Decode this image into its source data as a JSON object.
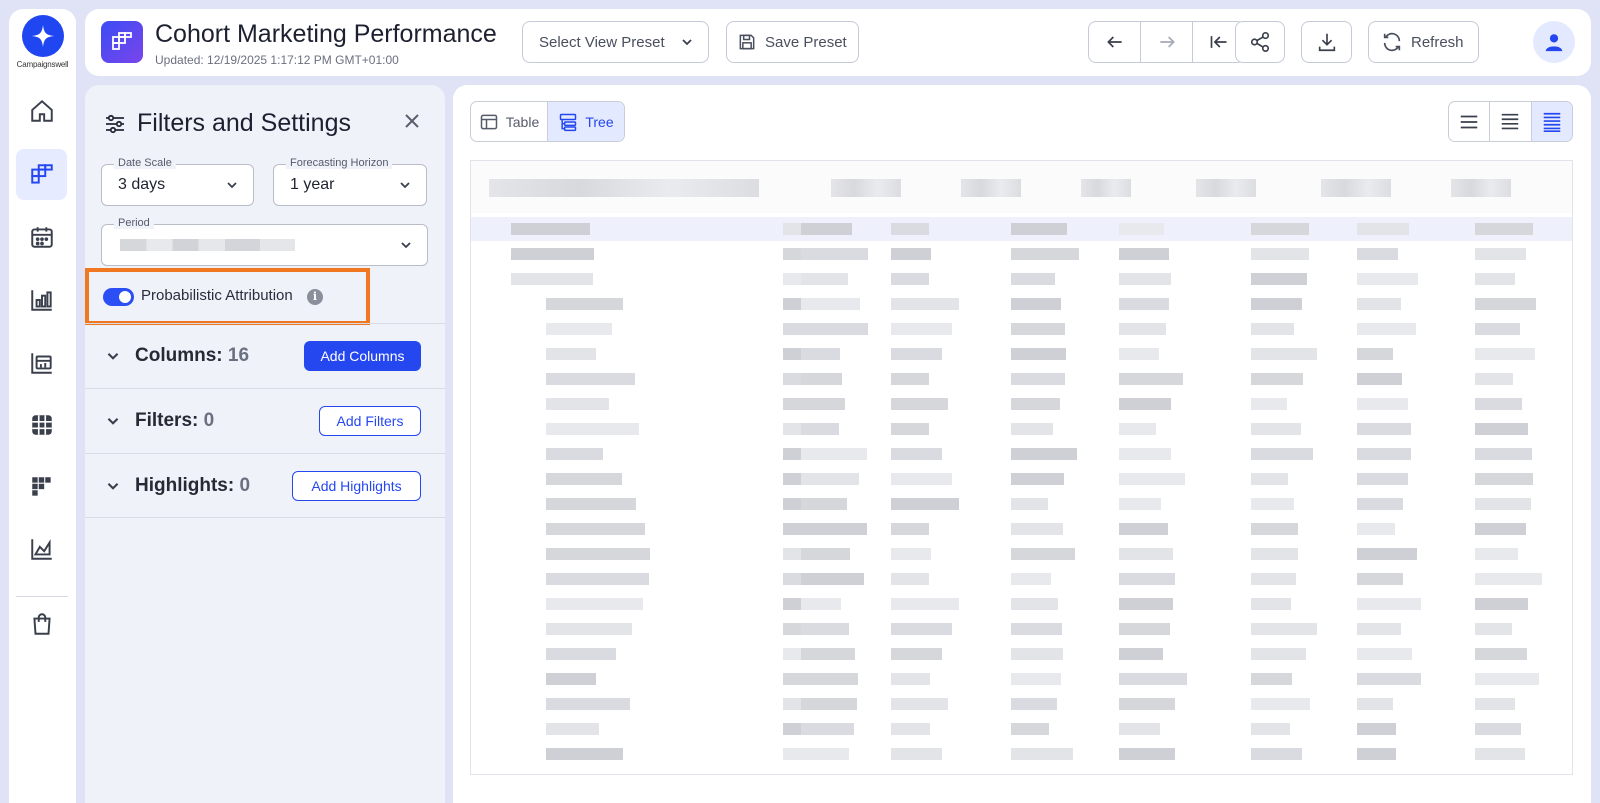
{
  "brand": {
    "name": "Campaignswell",
    "accent": "#2547f0",
    "highlight": "#f07820"
  },
  "header": {
    "title": "Cohort Marketing Performance",
    "updated": "Updated: 12/19/2025 1:17:12 PM GMT+01:00",
    "preset_select": "Select View Preset",
    "save_preset": "Save Preset",
    "refresh": "Refresh"
  },
  "sidebar": {
    "items": [
      {
        "icon": "home-icon",
        "active": false
      },
      {
        "icon": "cohort-icon",
        "active": true
      },
      {
        "icon": "calendar-icon",
        "active": false
      },
      {
        "icon": "bar-chart-icon",
        "active": false
      },
      {
        "icon": "calendar-chart-icon",
        "active": false
      },
      {
        "icon": "grid-icon",
        "active": false
      },
      {
        "icon": "heatmap-icon",
        "active": false
      },
      {
        "icon": "line-chart-icon",
        "active": false
      },
      {
        "icon": "shopping-bag-icon",
        "active": false
      }
    ]
  },
  "filters": {
    "title": "Filters and Settings",
    "date_scale": {
      "label": "Date Scale",
      "value": "3 days"
    },
    "forecasting_horizon": {
      "label": "Forecasting Horizon",
      "value": "1 year"
    },
    "period": {
      "label": "Period",
      "value": ""
    },
    "probabilistic_attribution": {
      "label": "Probabilistic Attribution",
      "enabled": true
    },
    "columns": {
      "label": "Columns:",
      "count": "16",
      "button": "Add Columns"
    },
    "filters": {
      "label": "Filters:",
      "count": "0",
      "button": "Add Filters"
    },
    "highlights": {
      "label": "Highlights:",
      "count": "0",
      "button": "Add Highlights"
    }
  },
  "main": {
    "view_tabs": [
      {
        "label": "Table",
        "active": false
      },
      {
        "label": "Tree",
        "active": true
      }
    ],
    "density_options": [
      "compact",
      "standard",
      "comfortable"
    ],
    "density_selected": "comfortable"
  }
}
